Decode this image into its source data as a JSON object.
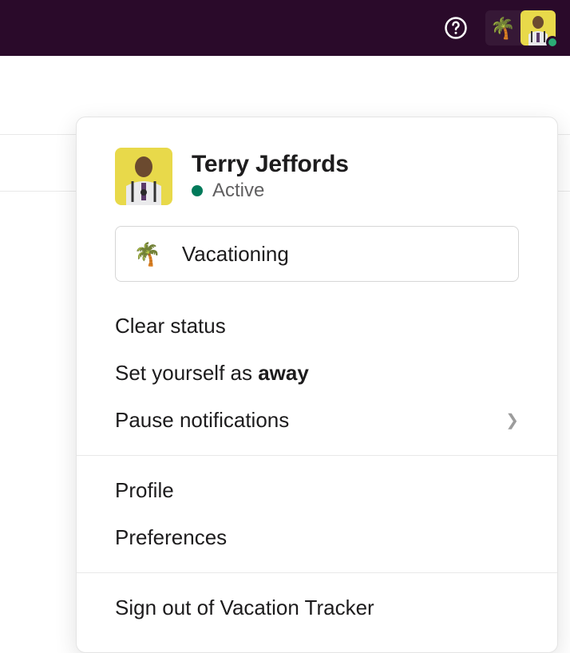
{
  "topbar": {
    "status_emoji": "🌴"
  },
  "user": {
    "name": "Terry Jeffords",
    "presence": "Active"
  },
  "status": {
    "emoji": "🌴",
    "text": "Vacationing"
  },
  "menu": {
    "clear_status": "Clear status",
    "set_away_prefix": "Set yourself as ",
    "set_away_bold": "away",
    "pause_notifications": "Pause notifications",
    "profile": "Profile",
    "preferences": "Preferences",
    "sign_out": "Sign out of Vacation Tracker"
  }
}
